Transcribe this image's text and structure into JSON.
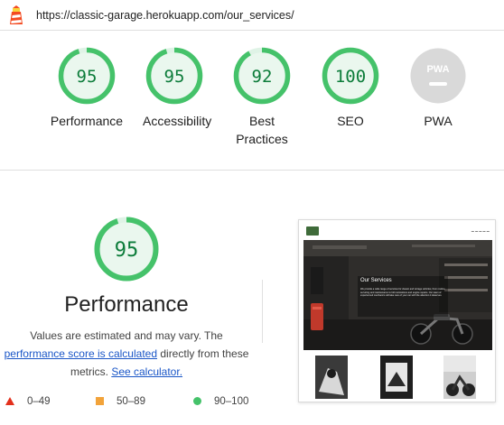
{
  "url": "https://classic-garage.herokuapp.com/our_services/",
  "colors": {
    "pass_green": "#0c7c3a",
    "gauge_green": "#45c26a",
    "gauge_track": "#dff3e6",
    "gauge_fill_bg": "#eaf7ee",
    "average_orange": "#f2a33a",
    "fail_red": "#e3301c",
    "pwa_gray": "#d9d9d9",
    "link_blue": "#1a56c7"
  },
  "scores": [
    {
      "id": "performance",
      "score": "95",
      "label": "Performance",
      "fraction": 0.95
    },
    {
      "id": "accessibility",
      "score": "95",
      "label": "Accessibility",
      "fraction": 0.95
    },
    {
      "id": "best-practices",
      "score": "92",
      "label": "Best Practices",
      "fraction": 0.92
    },
    {
      "id": "seo",
      "score": "100",
      "label": "SEO",
      "fraction": 1.0
    },
    {
      "id": "pwa",
      "score": "",
      "label": "PWA",
      "badge_text": "PWA",
      "fraction": 0
    }
  ],
  "performance": {
    "score": "95",
    "fraction": 0.95,
    "title": "Performance",
    "desc_line1": "Values are estimated and may vary. The",
    "link_score": "performance score is calculated",
    "desc_mid": " directly from these metrics. ",
    "link_calc": "See calculator."
  },
  "legend": {
    "fail": "0–49",
    "average": "50–89",
    "pass": "90–100"
  },
  "screenshot": {
    "hero_heading": "Our Services",
    "hero_text": "We provide a wide range of services for classic and vintage vehicles, from routine servicing and maintenance to full restorations and engine repairs. Our team of experienced mechanics will take care of your car with the attention it deserves."
  }
}
